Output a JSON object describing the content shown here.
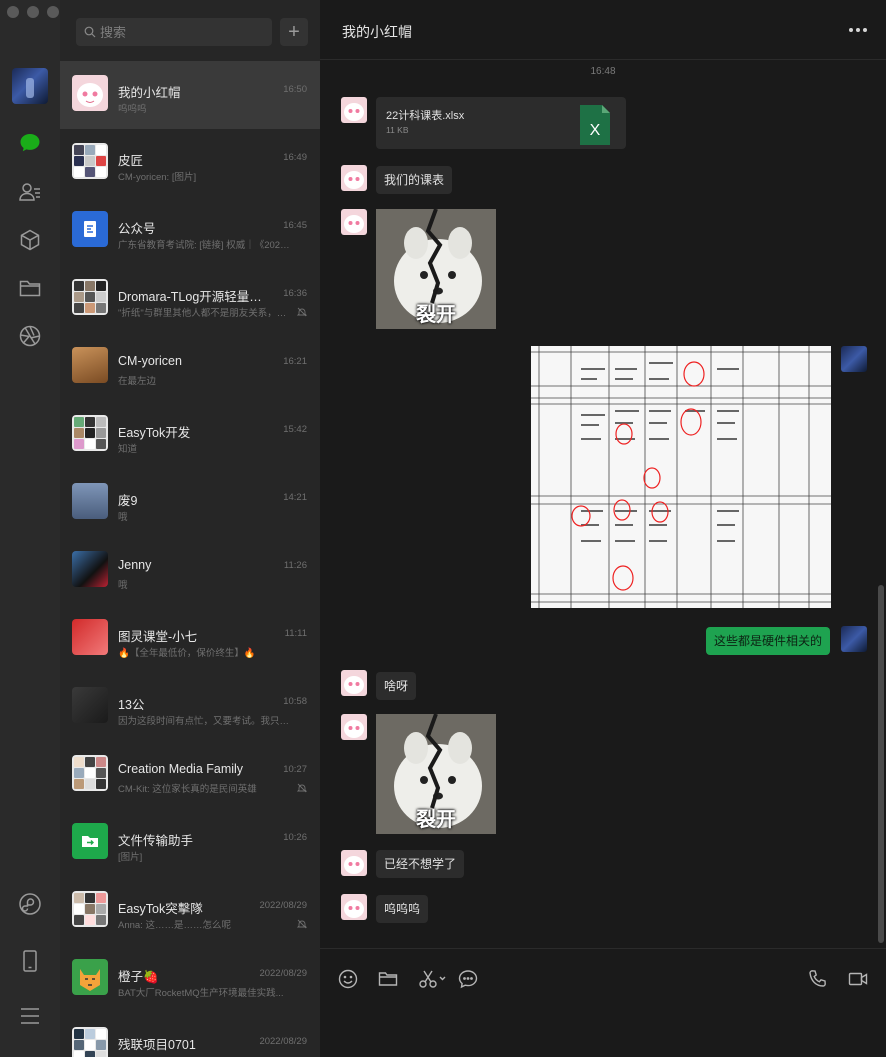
{
  "search": {
    "placeholder": "搜索"
  },
  "add_button": {
    "label": "+"
  },
  "conversations": [
    {
      "name": "我的小红帽",
      "time": "16:50",
      "preview": "呜呜呜",
      "active": true,
      "muted": false
    },
    {
      "name": "皮匠",
      "time": "16:49",
      "preview": "CM-yoricen: [图片]",
      "active": false,
      "muted": false
    },
    {
      "name": "公众号",
      "time": "16:45",
      "preview": "广东省教育考试院: [链接] 权威｜《2023年...",
      "active": false,
      "muted": false
    },
    {
      "name": "Dromara-TLog开源轻量级日...",
      "time": "16:36",
      "preview": "\"折纸\"与群里其他人都不是朋友关系，请...",
      "active": false,
      "muted": true
    },
    {
      "name": "CM-yoricen",
      "time": "16:21",
      "preview": "在最左边",
      "active": false,
      "muted": false
    },
    {
      "name": "EasyTok开发",
      "time": "15:42",
      "preview": "知道",
      "active": false,
      "muted": false
    },
    {
      "name": "废9",
      "time": "14:21",
      "preview": "哦",
      "active": false,
      "muted": false
    },
    {
      "name": "Jenny",
      "time": "11:26",
      "preview": "哦",
      "active": false,
      "muted": false
    },
    {
      "name": "图灵课堂-小七",
      "time": "11:11",
      "preview": "🔥【全年最低价，保价终生】🔥",
      "active": false,
      "muted": false
    },
    {
      "name": "13公",
      "time": "10:58",
      "preview": "因为这段时间有点忙，又要考试。我只能每...",
      "active": false,
      "muted": false
    },
    {
      "name": "Creation Media Family",
      "time": "10:27",
      "preview": "CM-Kit: 这位家长真的是民间英雄",
      "active": false,
      "muted": true
    },
    {
      "name": "文件传输助手",
      "time": "10:26",
      "preview": "[图片]",
      "active": false,
      "muted": false
    },
    {
      "name": "EasyTok突擊隊",
      "time": "2022/08/29",
      "preview": "Anna: 这……是……怎么呢",
      "active": false,
      "muted": true
    },
    {
      "name": "橙子🍓",
      "time": "2022/08/29",
      "preview": "BAT大厂RocketMQ生产环境最佳实践...",
      "active": false,
      "muted": false
    },
    {
      "name": "残联项目0701",
      "time": "2022/08/29",
      "preview": "",
      "active": false,
      "muted": false
    }
  ],
  "chat": {
    "title": "我的小红帽",
    "timestamp": "16:48",
    "file": {
      "name": "22计科课表.xlsx",
      "size": "11 KB",
      "icon_letter": "X"
    },
    "messages": {
      "m1": "我们的课表",
      "self1": "这些都是硬件相关的",
      "m2": "啥呀",
      "m3": "已经不想学了",
      "m4": "呜呜呜"
    },
    "sticker_caption": "裂开"
  },
  "colors": {
    "self_bubble": "#1ea350",
    "other_bubble": "#2c2c2c",
    "active_chat_icon": "#1aad19",
    "excel": "#1e7145"
  },
  "icons": {
    "rail": [
      "chat-icon",
      "contacts-icon",
      "box-icon",
      "folder-icon",
      "shutter-icon",
      "mini-program-icon",
      "phone-icon",
      "menu-icon"
    ],
    "toolbar": [
      "emoji-icon",
      "folder-icon",
      "scissors-icon",
      "chat-bubble-icon",
      "call-icon",
      "video-icon"
    ]
  }
}
